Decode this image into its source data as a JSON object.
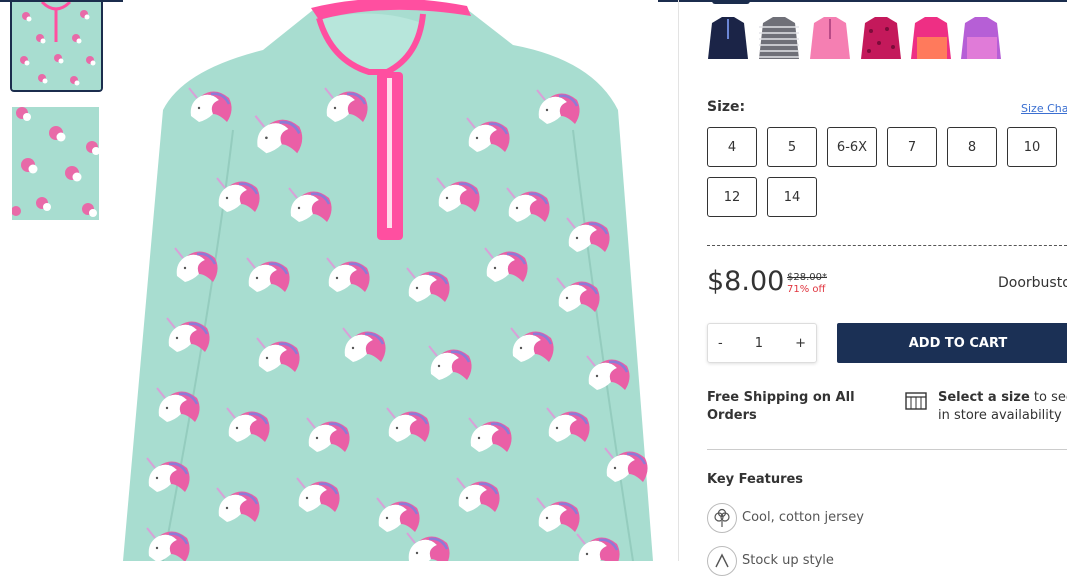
{
  "gallery": {
    "thumbnails": [
      "unicode fleece front",
      "unicode fleece detail"
    ]
  },
  "colors": {
    "accent": "#1b3055",
    "print_bg": "#a8ddd0",
    "trim_pink": "#ff4fa0",
    "sale_red": "#e0353f",
    "link_blue": "#3a6fd1"
  },
  "swatches": [
    {
      "name": "navy",
      "color": "#1b2447"
    },
    {
      "name": "stripe",
      "color": "#7e7f86"
    },
    {
      "name": "pink",
      "color": "#f57fb2"
    },
    {
      "name": "raspberry-print",
      "color": "#c4195b"
    },
    {
      "name": "pink-coral",
      "color": "#ee2f84"
    },
    {
      "name": "purple",
      "color": "#b65fd6"
    }
  ],
  "size": {
    "label": "Size:",
    "chart_link": "Size Cha",
    "options": [
      "4",
      "5",
      "6-6X",
      "7",
      "8",
      "10",
      "12",
      "14"
    ]
  },
  "price": {
    "current": "$8.00",
    "original": "$28.00*",
    "discount": "71% off",
    "promo": "Doorbusto"
  },
  "quantity": {
    "minus": "-",
    "value": "1",
    "plus": "+"
  },
  "cart": {
    "add_label": "ADD TO CART"
  },
  "shipping": {
    "free_shipping": "Free Shipping on All Orders",
    "store_bold": "Select a size",
    "store_rest": " to see",
    "store_line2": "in store availability"
  },
  "key_features": {
    "title": "Key Features",
    "items": [
      {
        "icon": "cotton-icon",
        "text": "Cool, cotton jersey"
      },
      {
        "icon": "stock-icon",
        "text": "Stock up style"
      }
    ]
  }
}
